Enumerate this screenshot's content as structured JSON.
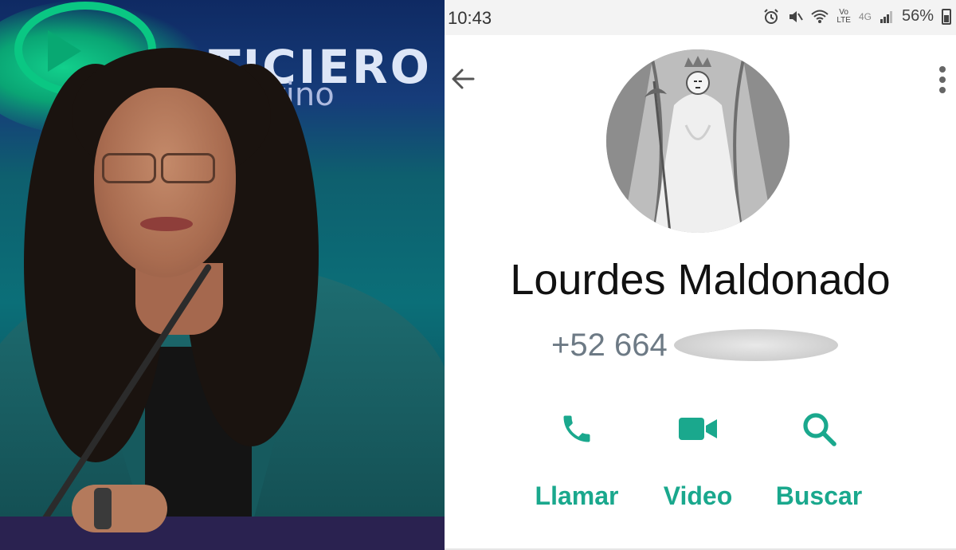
{
  "photo": {
    "brand_text": "TICIERO",
    "brand_subtext": "ertino"
  },
  "status_bar": {
    "time": "10:43",
    "battery": "56%",
    "network": "4G",
    "volte": "LTE",
    "icons": [
      "alarm-icon",
      "mute-icon",
      "wifi-icon",
      "volte-icon",
      "signal-icon",
      "battery-icon"
    ]
  },
  "toolbar": {
    "back_icon": "back-arrow-icon",
    "menu_icon": "more-vert-icon"
  },
  "contact": {
    "name": "Lourdes Maldonado",
    "phone_visible": "+52 664"
  },
  "actions": [
    {
      "label": "Llamar",
      "icon": "phone-icon"
    },
    {
      "label": "Video",
      "icon": "video-icon"
    },
    {
      "label": "Buscar",
      "icon": "search-icon"
    }
  ],
  "colors": {
    "accent": "#1aa88d",
    "text_primary": "#111111",
    "text_secondary": "#6d7a85"
  }
}
